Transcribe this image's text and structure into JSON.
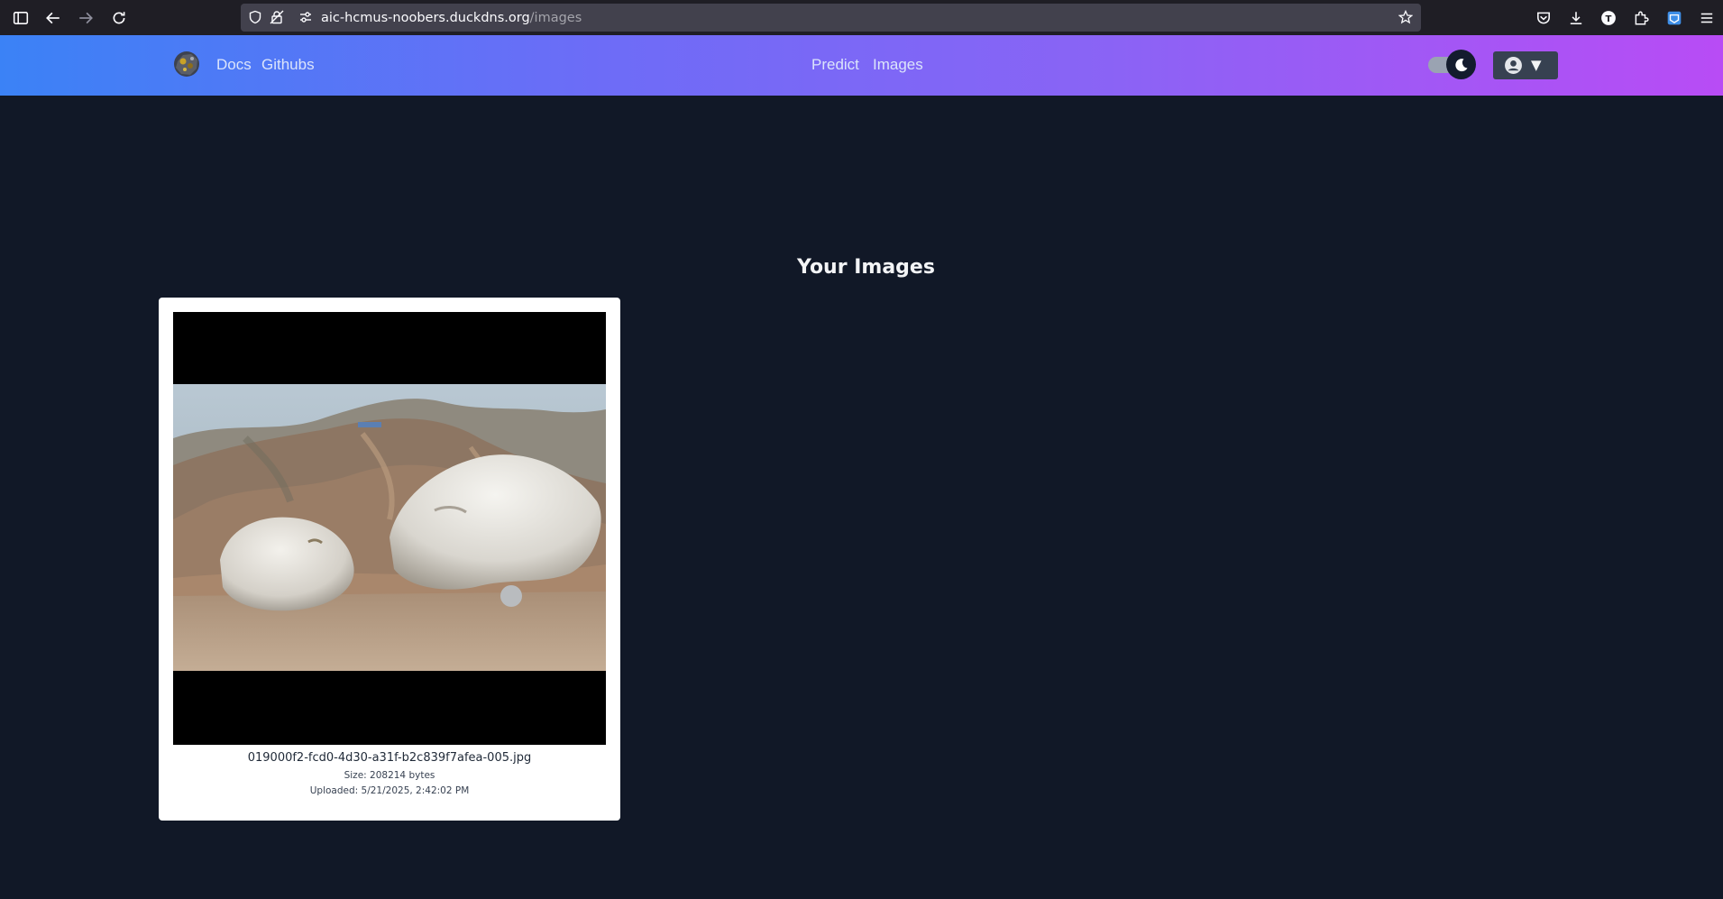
{
  "browser": {
    "url_host": "aic-hcmus-noobers.duckdns.org",
    "url_path": "/images"
  },
  "navbar": {
    "links_left": [
      "Docs",
      "Githubs"
    ],
    "links_center": [
      "Predict",
      "Images"
    ],
    "theme_toggle": "dark",
    "user_menu_caret": "▼"
  },
  "main": {
    "title": "Your Images",
    "images": [
      {
        "filename": "019000f2-fcd0-4d30-a31f-b2c839f7afea-005.jpg",
        "size_label": "Size:",
        "size_value": "208214 bytes",
        "uploaded_label": "Uploaded:",
        "uploaded_value": "5/21/2025, 2:42:02 PM"
      }
    ]
  },
  "colors": {
    "page_bg": "#111827",
    "navbar_gradient_start": "#3b82f6",
    "navbar_gradient_end": "#b84cf5",
    "card_bg": "#ffffff"
  },
  "icons": [
    "sidebar-icon",
    "back-arrow-icon",
    "forward-arrow-icon",
    "reload-icon",
    "shield-icon",
    "lock-icon",
    "permissions-icon",
    "star-icon",
    "pocket-icon",
    "download-icon",
    "profile-t-icon",
    "extensions-icon",
    "account-box-icon",
    "hamburger-menu-icon",
    "moon-icon",
    "user-circle-icon"
  ]
}
